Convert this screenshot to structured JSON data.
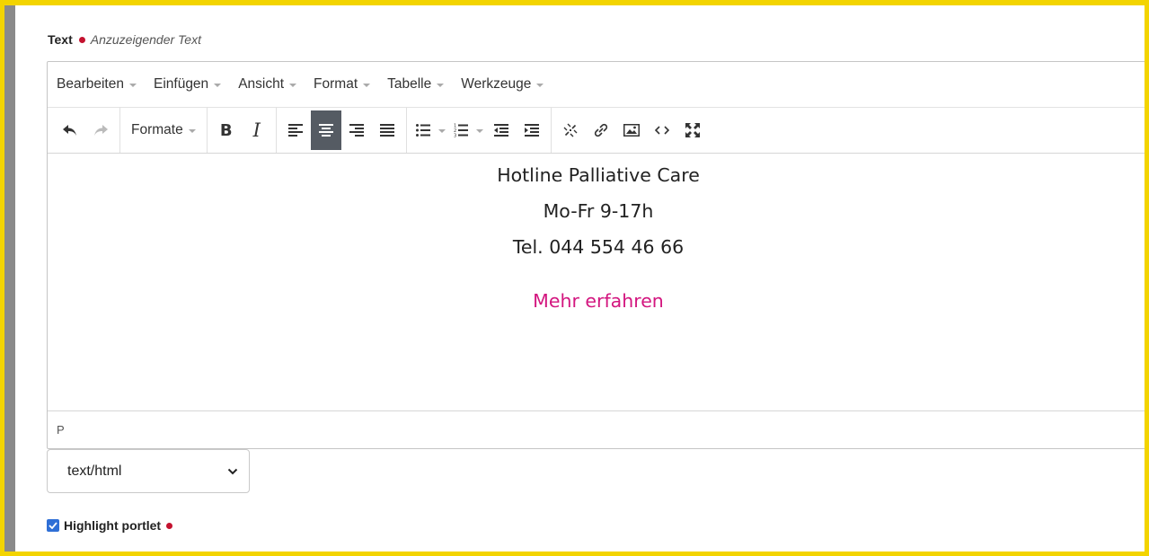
{
  "field": {
    "label": "Text",
    "hint": "Anzuzeigender Text",
    "required_color": "#c4122f"
  },
  "editor": {
    "menu": [
      "Bearbeiten",
      "Einfügen",
      "Ansicht",
      "Format",
      "Tabelle",
      "Werkzeuge"
    ],
    "toolbar": {
      "formats_label": "Formate",
      "bold_label": "B",
      "italic_label": "I",
      "icons": [
        "undo-icon",
        "redo-icon",
        "align-left-icon",
        "align-center-icon",
        "align-right-icon",
        "align-justify-icon",
        "bullet-list-icon",
        "numbered-list-icon",
        "outdent-icon",
        "indent-icon",
        "unlink-icon",
        "link-icon",
        "image-icon",
        "code-icon",
        "fullscreen-icon"
      ],
      "active": "align-center-icon"
    },
    "content": {
      "lines": [
        "Hotline Palliative Care",
        "Mo-Fr 9-17h",
        "Tel. 044 554 46 66"
      ],
      "link_text": "Mehr erfahren",
      "link_color": "#d3167f"
    },
    "status_path": "P"
  },
  "mimetype": {
    "selected": "text/html"
  },
  "highlight": {
    "label": "Highlight portlet",
    "checked": true
  },
  "colors": {
    "border_highlight": "#f3d400",
    "active_button": "#555b63",
    "checkbox": "#2f6fd6"
  }
}
